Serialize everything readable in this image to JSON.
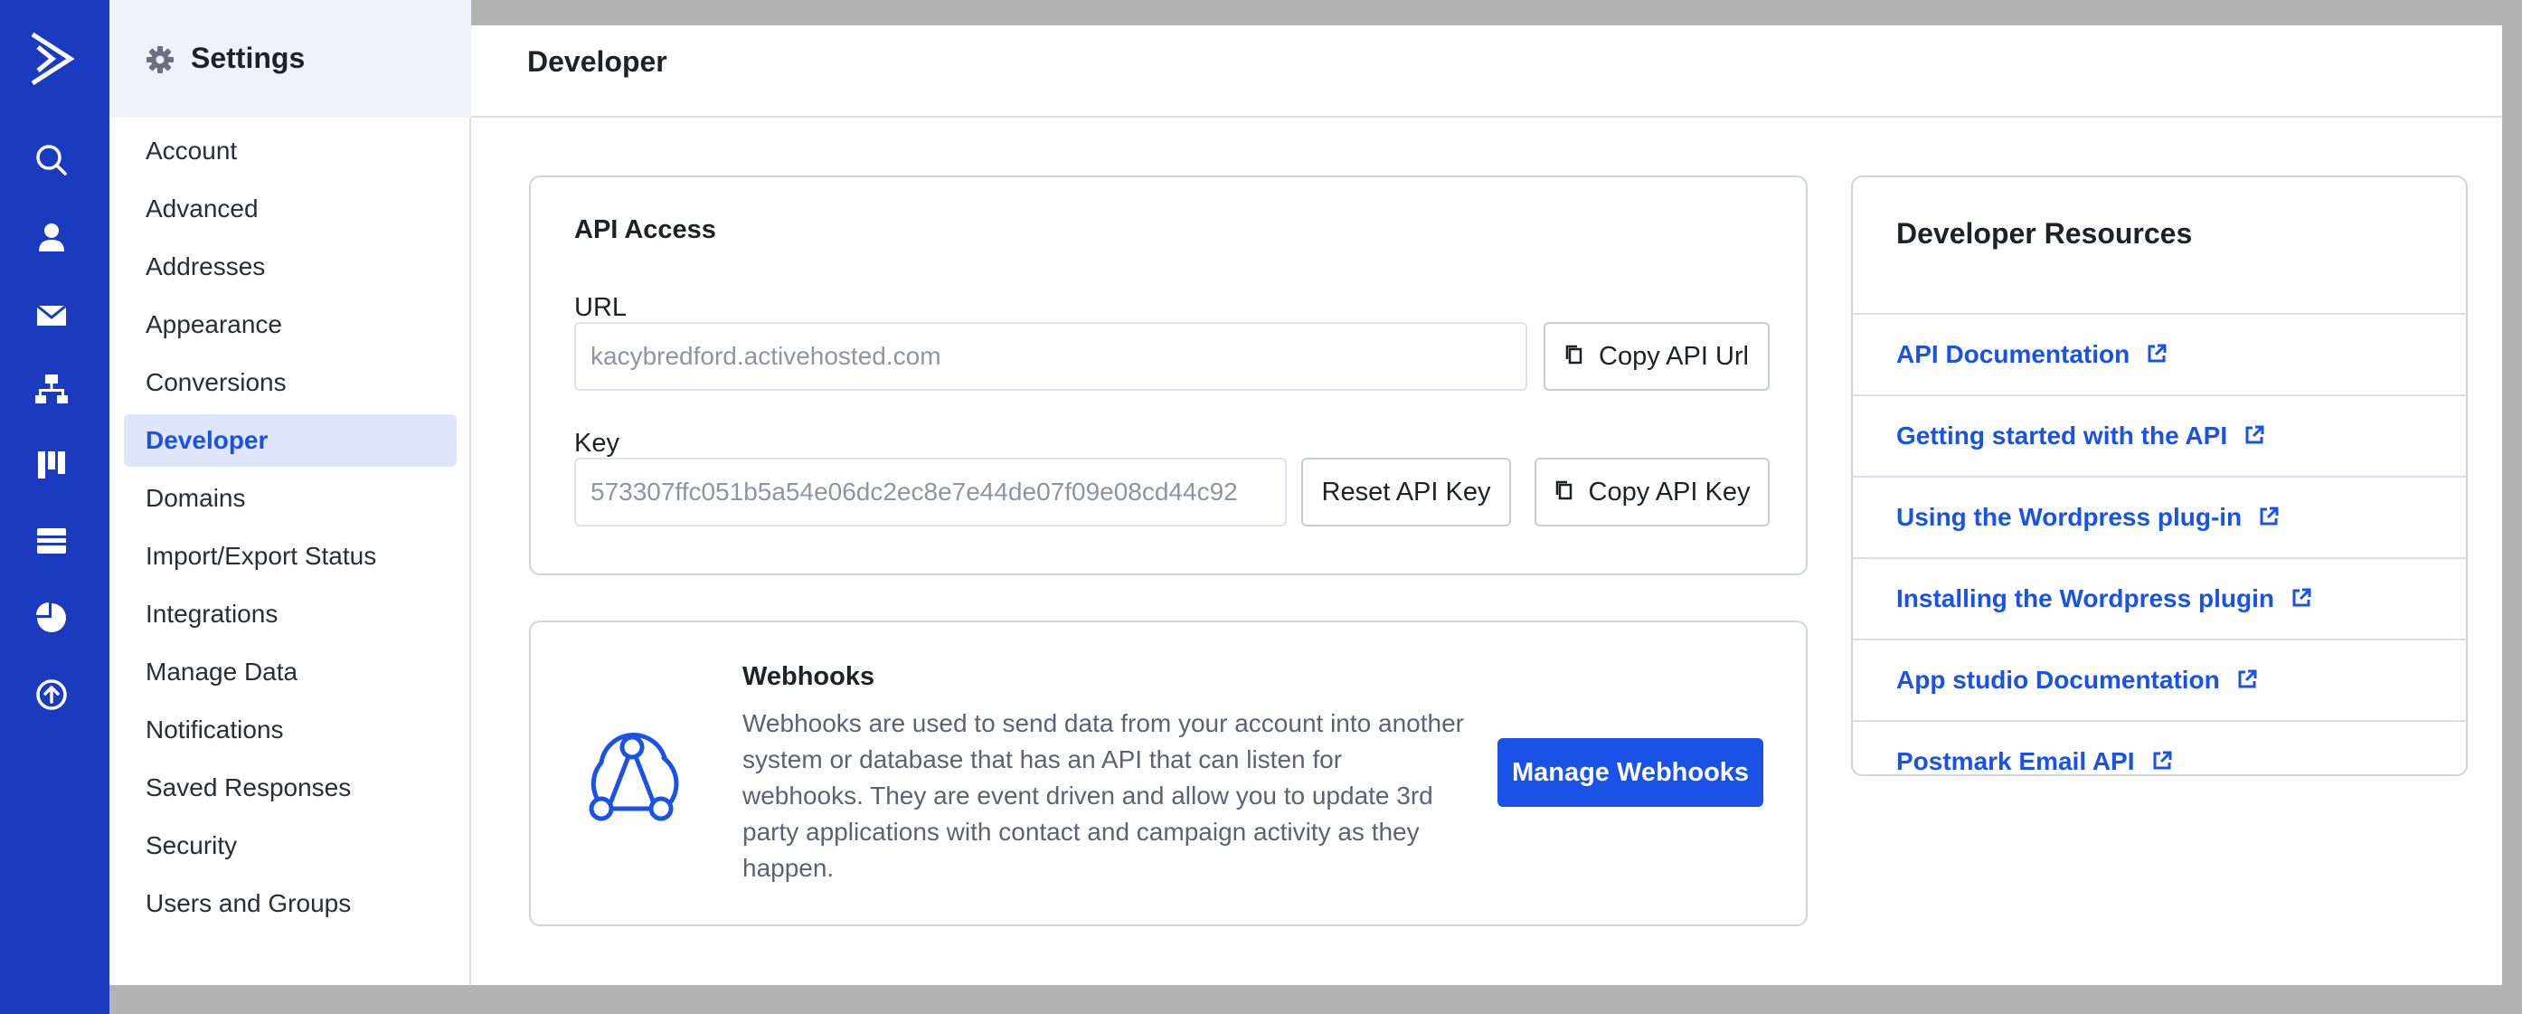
{
  "colors": {
    "rail": "#1a3bbf",
    "accent": "#1a52e8",
    "active_bg": "#dfe6fb"
  },
  "rail": {
    "icons": [
      "logo-icon",
      "search-icon",
      "contact-icon",
      "mail-icon",
      "automation-icon",
      "pipeline-icon",
      "site-icon",
      "reports-icon",
      "upgrade-icon"
    ]
  },
  "sidebar": {
    "title": "Settings",
    "items": [
      {
        "label": "Account"
      },
      {
        "label": "Advanced"
      },
      {
        "label": "Addresses"
      },
      {
        "label": "Appearance"
      },
      {
        "label": "Conversions"
      },
      {
        "label": "Developer",
        "active": true
      },
      {
        "label": "Domains"
      },
      {
        "label": "Import/Export Status"
      },
      {
        "label": "Integrations"
      },
      {
        "label": "Manage Data"
      },
      {
        "label": "Notifications"
      },
      {
        "label": "Saved Responses"
      },
      {
        "label": "Security"
      },
      {
        "label": "Users and Groups"
      }
    ]
  },
  "main": {
    "title": "Developer",
    "api": {
      "heading": "API Access",
      "url_label": "URL",
      "url_value": "kacybredford.activehosted.com",
      "copy_url": "Copy API Url",
      "key_label": "Key",
      "key_value": "573307ffc051b5a54e06dc2ec8e7e44de07f09e08cd44c92",
      "reset_key": "Reset API Key",
      "copy_key": "Copy API Key"
    },
    "webhooks": {
      "heading": "Webhooks",
      "description": "Webhooks are used to send data from your account into another system or database that has an API that can listen for webhooks. They are event driven and allow you to update 3rd party applications with contact and campaign activity as they happen.",
      "button": "Manage Webhooks"
    },
    "resources": {
      "heading": "Developer Resources",
      "links": [
        {
          "label": "API Documentation"
        },
        {
          "label": "Getting started with the API"
        },
        {
          "label": "Using the Wordpress plug-in"
        },
        {
          "label": "Installing the Wordpress plugin"
        },
        {
          "label": "App studio Documentation"
        },
        {
          "label": "Postmark Email API"
        }
      ]
    }
  }
}
